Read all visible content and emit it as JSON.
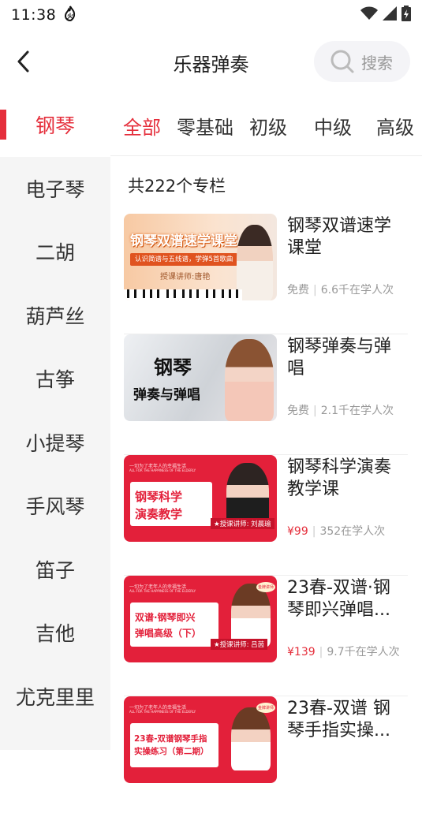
{
  "status": {
    "time": "11:38",
    "notif_icon": "flame-icon"
  },
  "header": {
    "title": "乐器弹奏",
    "search_label": "搜索"
  },
  "sidebar": {
    "items": [
      {
        "label": "钢琴",
        "active": true
      },
      {
        "label": "电子琴"
      },
      {
        "label": "二胡"
      },
      {
        "label": "葫芦丝"
      },
      {
        "label": "古筝"
      },
      {
        "label": "小提琴"
      },
      {
        "label": "手风琴"
      },
      {
        "label": "笛子"
      },
      {
        "label": "吉他"
      },
      {
        "label": "尤克里里"
      },
      {
        "label": ""
      }
    ]
  },
  "tabs": [
    "全部",
    "零基础",
    "初级",
    "中级",
    "高级"
  ],
  "count_text": "共222个专栏",
  "courses": [
    {
      "title": "钢琴双谱速学课堂",
      "price": "免费",
      "learners": "6.6千在学人次",
      "thumb": {
        "headline": "钢琴双谱速学课堂",
        "sub": "认识简谱与五线谱，学弹5首歌曲",
        "teacher": "授课讲师:唐艳"
      }
    },
    {
      "title": "钢琴弹奏与弹唱",
      "price": "免费",
      "learners": "2.1千在学人次",
      "thumb": {
        "line1": "钢琴",
        "line2": "弹奏与弹唱"
      }
    },
    {
      "title": "钢琴科学演奏教学课",
      "price": "¥99",
      "learners": "352在学人次",
      "thumb": {
        "top": "一切为了老年人的幸福生活",
        "top2": "ALL FOR THE HAPPINESS OF THE ELDERLY",
        "line1": "钢琴科学",
        "line2": "演奏教学",
        "teacher": "★授课讲师: 刘晨瑜"
      }
    },
    {
      "title": "23春-双谱·钢琴即兴弹唱...",
      "price": "¥139",
      "learners": "9.7千在学人次",
      "thumb": {
        "top": "一切为了老年人的幸福生活",
        "top2": "ALL FOR THE HAPPINESS OF THE ELDERLY",
        "line1": "双谱·钢琴即兴",
        "line2": "弹唱高级（下）",
        "teacher": "★授课讲师: 吕茵",
        "badge": "金牌讲师"
      }
    },
    {
      "title": "23春-双谱 钢琴手指实操...",
      "price": "",
      "learners": "",
      "thumb": {
        "top": "一切为了老年人的幸福生活",
        "top2": "ALL FOR THE HAPPINESS OF THE ELDERLY",
        "line1": "23春-双谱钢琴手指",
        "line2": "实操练习（第二期）",
        "badge": "金牌讲师"
      }
    }
  ],
  "colors": {
    "accent": "#e52e3b",
    "sidebar_bg": "#f5f5f5",
    "meta": "#999999"
  }
}
